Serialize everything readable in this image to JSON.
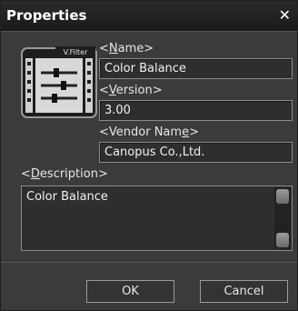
{
  "window": {
    "title": "Properties",
    "close_glyph": "✕"
  },
  "icon": {
    "name": "video-filter-icon",
    "caption": "V.Filter"
  },
  "fields": {
    "name": {
      "label_pre": "<",
      "label_u": "N",
      "label_post": "ame>",
      "value": "Color Balance"
    },
    "version": {
      "label_pre": "<",
      "label_u": "V",
      "label_post": "ersion>",
      "value": "3.00"
    },
    "vendor": {
      "label_pre": "<Vendor Nam",
      "label_u": "e",
      "label_post": ">",
      "value": "Canopus Co.,Ltd."
    },
    "description": {
      "label_pre": "<",
      "label_u": "D",
      "label_post": "escription>",
      "value": "Color Balance"
    }
  },
  "buttons": {
    "ok": "OK",
    "cancel": "Cancel"
  }
}
